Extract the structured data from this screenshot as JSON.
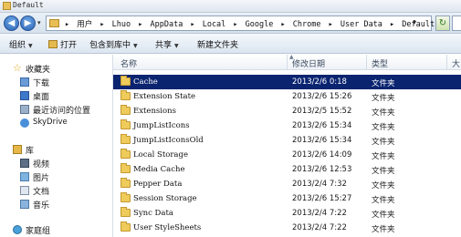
{
  "window": {
    "title": "Default"
  },
  "address": {
    "path": [
      "用户",
      "Lhuo",
      "AppData",
      "Local",
      "Google",
      "Chrome",
      "User Data",
      "Default"
    ],
    "separator": "▸"
  },
  "toolbar": {
    "organize": "组织",
    "open": "打开",
    "include_in_library": "包含到库中",
    "share": "共享",
    "new_folder": "新建文件夹"
  },
  "nav": {
    "favorites": "收藏夹",
    "downloads": "下载",
    "desktop": "桌面",
    "recent": "最近访问的位置",
    "skydrive": "SkyDrive",
    "libraries": "库",
    "videos": "视频",
    "pictures": "图片",
    "documents": "文档",
    "music": "音乐",
    "homegroup": "家庭组"
  },
  "columns": {
    "name": "名称",
    "date": "修改日期",
    "type": "类型",
    "size": "大"
  },
  "files": [
    {
      "name": "Cache",
      "date": "2013/2/6 0:18",
      "type": "文件夹",
      "selected": true
    },
    {
      "name": "Extension State",
      "date": "2013/2/6 15:26",
      "type": "文件夹"
    },
    {
      "name": "Extensions",
      "date": "2013/2/5 15:52",
      "type": "文件夹"
    },
    {
      "name": "JumpListIcons",
      "date": "2013/2/6 15:34",
      "type": "文件夹"
    },
    {
      "name": "JumpListIconsOld",
      "date": "2013/2/6 15:34",
      "type": "文件夹"
    },
    {
      "name": "Local Storage",
      "date": "2013/2/6 14:09",
      "type": "文件夹"
    },
    {
      "name": "Media Cache",
      "date": "2013/2/6 12:53",
      "type": "文件夹"
    },
    {
      "name": "Pepper Data",
      "date": "2013/2/4 7:32",
      "type": "文件夹"
    },
    {
      "name": "Session Storage",
      "date": "2013/2/6 15:27",
      "type": "文件夹"
    },
    {
      "name": "Sync Data",
      "date": "2013/2/4 7:22",
      "type": "文件夹"
    },
    {
      "name": "User StyleSheets",
      "date": "2013/2/4 7:22",
      "type": "文件夹"
    }
  ],
  "icons": {
    "back": "arrow-left-icon",
    "forward": "arrow-right-icon",
    "refresh": "refresh-icon",
    "folder": "folder-icon"
  },
  "colors": {
    "selection": "#0a2470",
    "folder": "#eecb5a"
  }
}
